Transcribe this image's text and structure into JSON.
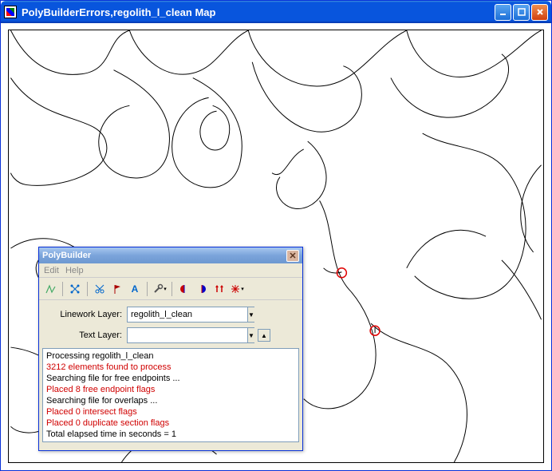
{
  "main": {
    "title": "PolyBuilderErrors,regolith_l_clean Map"
  },
  "dialog": {
    "title": "PolyBuilder",
    "menu": {
      "edit": "Edit",
      "help": "Help"
    },
    "fields": {
      "linework_label": "Linework Layer:",
      "linework_value": "regolith_l_clean",
      "text_label": "Text Layer:",
      "text_value": ""
    },
    "log": {
      "l1": "Processing regolith_l_clean",
      "l2": "3212 elements found to process",
      "l3": "Searching file for free endpoints ...",
      "l4": "Placed 8 free endpoint flags",
      "l5": "Searching file for overlaps ...",
      "l6": "Placed 0 intersect flags",
      "l7": "Placed 0 duplicate section flags",
      "l8": "Total elapsed time in seconds = 1"
    }
  }
}
